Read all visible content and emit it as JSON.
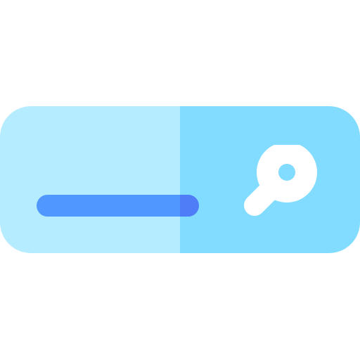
{
  "icon": {
    "name": "search-bar-icon",
    "colors": {
      "bar_left": "#b5ecff",
      "bar_right": "#82dcff",
      "input_line_left": "#5098ff",
      "input_line_right": "#4e7df7",
      "search_icon": "#ffffff",
      "lens_inner": "#82dcff"
    },
    "glyphs": {
      "search": "magnifier-icon"
    }
  }
}
